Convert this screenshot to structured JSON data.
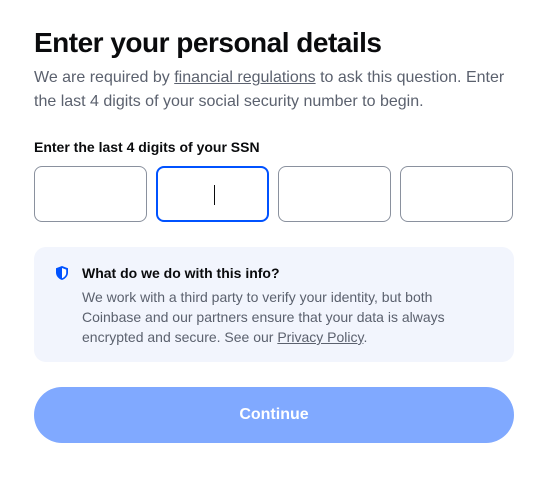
{
  "header": {
    "title": "Enter your personal details",
    "subtitle_prefix": "We are required by ",
    "subtitle_link": "financial regulations",
    "subtitle_suffix": " to ask this question. Enter the last 4 digits of your social security number to begin."
  },
  "ssn": {
    "label": "Enter the last 4 digits of your SSN",
    "digits": [
      "",
      "",
      "",
      ""
    ],
    "focused_index": 1
  },
  "info": {
    "icon": "shield-icon",
    "title": "What do we do with this info?",
    "body_prefix": "We work with a third party to verify your identity, but both Coinbase and our partners ensure that your data is always encrypted and secure. See our ",
    "body_link": "Privacy Policy",
    "body_suffix": "."
  },
  "actions": {
    "continue_label": "Continue"
  },
  "colors": {
    "accent": "#0052ff",
    "button_disabled": "#80a9ff",
    "info_bg": "#f2f5fd",
    "muted_text": "#5b616e"
  }
}
